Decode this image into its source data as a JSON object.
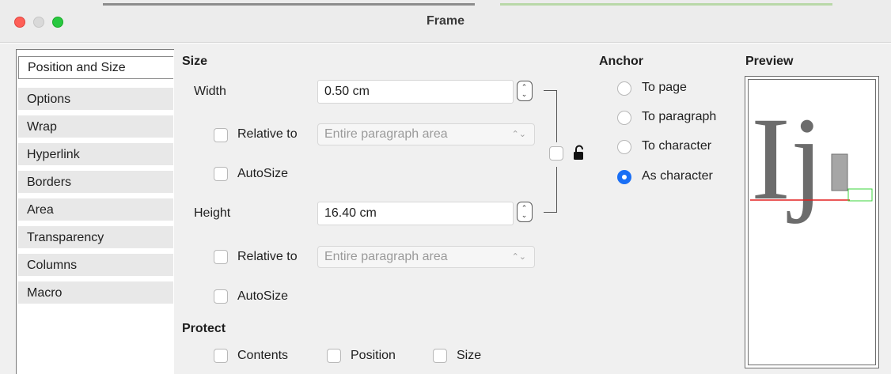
{
  "window": {
    "title": "Frame"
  },
  "tabs": [
    {
      "label": "Position and Size",
      "active": true
    },
    {
      "label": "Options"
    },
    {
      "label": "Wrap"
    },
    {
      "label": "Hyperlink"
    },
    {
      "label": "Borders"
    },
    {
      "label": "Area"
    },
    {
      "label": "Transparency"
    },
    {
      "label": "Columns"
    },
    {
      "label": "Macro"
    }
  ],
  "size": {
    "heading": "Size",
    "width_label": "Width",
    "width_value": "0.50 cm",
    "height_label": "Height",
    "height_value": "16.40 cm",
    "relative_to_label": "Relative to",
    "relative_to_placeholder": "Entire paragraph area",
    "autosize_label": "AutoSize"
  },
  "protect": {
    "heading": "Protect",
    "contents_label": "Contents",
    "position_label": "Position",
    "size_label": "Size"
  },
  "anchor": {
    "heading": "Anchor",
    "options": [
      "To page",
      "To paragraph",
      "To character",
      "As character"
    ],
    "selected": "As character"
  },
  "preview": {
    "heading": "Preview",
    "sample_glyphs": "Ij"
  },
  "colors": {
    "accent": "#1a6ff5",
    "baseline": "#e32020",
    "frame_outline": "#3bd43b"
  },
  "icons": {
    "lock": "unlocked-padlock-icon",
    "spin": "up-down-stepper-icon",
    "select": "up-down-chevron-icon"
  }
}
